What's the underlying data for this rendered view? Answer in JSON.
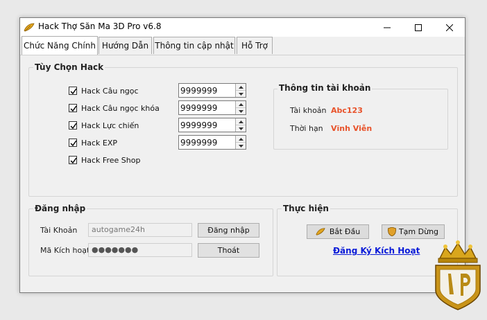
{
  "window": {
    "title": "Hack Thợ Săn Ma 3D Pro v6.8",
    "icons": {
      "app": "gold-feather-icon",
      "minimize": "minimize-icon",
      "maximize": "maximize-icon",
      "close": "close-icon"
    }
  },
  "tabs": [
    {
      "label": "Chức Năng Chính",
      "active": true
    },
    {
      "label": "Hướng Dẫn",
      "active": false
    },
    {
      "label": "Thông tin cập nhật",
      "active": false
    },
    {
      "label": "Hỗ Trợ",
      "active": false
    }
  ],
  "hack_options": {
    "title": "Tùy Chọn Hack",
    "items": [
      {
        "label": "Hack Câu ngọc",
        "checked": true,
        "value": "9999999"
      },
      {
        "label": "Hack Câu ngọc khóa",
        "checked": true,
        "value": "9999999"
      },
      {
        "label": "Hack Lực chiến",
        "checked": true,
        "value": "9999999"
      },
      {
        "label": "Hack EXP",
        "checked": true,
        "value": "9999999"
      },
      {
        "label": "Hack Free Shop",
        "checked": true
      }
    ]
  },
  "account_info": {
    "title": "Thông tin tài khoản",
    "account_label": "Tài khoản",
    "account_value": "Abc123",
    "duration_label": "Thời hạn",
    "duration_value": "Vĩnh Viễn",
    "value_color": "#e8522a"
  },
  "login": {
    "title": "Đăng nhập",
    "account_label": "Tài Khoản",
    "account_value": "autogame24h",
    "code_label": "Mã Kích hoạt",
    "code_value": "●●●●●●●",
    "login_button": "Đăng nhập",
    "exit_button": "Thoát"
  },
  "actions": {
    "title": "Thực hiện",
    "start_button": "Bắt Đầu",
    "start_icon": "feather-icon",
    "pause_button": "Tạm Dừng",
    "pause_icon": "shield-icon",
    "register_link": "Đăng Ký Kích Hoạt",
    "link_color": "#0a1bd8"
  },
  "watermark": {
    "icon": "crown-logo-icon"
  }
}
